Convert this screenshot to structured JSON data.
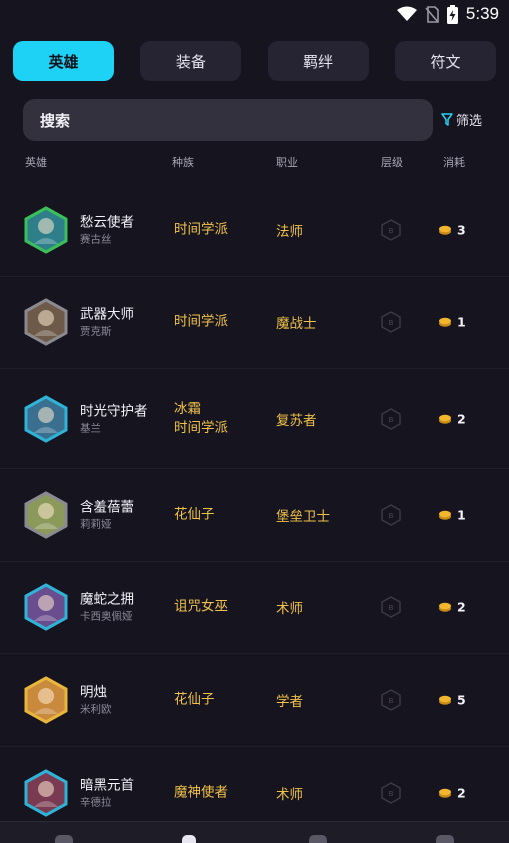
{
  "status_bar": {
    "time": "5:39",
    "icons": [
      "wifi-icon",
      "no-sim-icon",
      "battery-charging-icon"
    ]
  },
  "tabs": [
    {
      "label": "英雄",
      "active": true
    },
    {
      "label": "装备",
      "active": false
    },
    {
      "label": "羁绊",
      "active": false
    },
    {
      "label": "符文",
      "active": false
    }
  ],
  "search": {
    "placeholder": "搜索"
  },
  "filter": {
    "label": "筛选",
    "icon": "filter-icon"
  },
  "columns": {
    "hero": "英雄",
    "origin": "种族",
    "class": "职业",
    "tier": "层级",
    "cost": "消耗"
  },
  "tier_badge": "B",
  "heroes": [
    {
      "name": "愁云使者",
      "subname": "赛古丝",
      "origin": "时间学派",
      "class": "法师",
      "cost": "3",
      "border": "#3bbf5a",
      "portrait": "#2e7f8a"
    },
    {
      "name": "武器大师",
      "subname": "贾克斯",
      "origin": "时间学派",
      "class": "魔战士",
      "cost": "1",
      "border": "#8a8a90",
      "portrait": "#6d5a48"
    },
    {
      "name": "时光守护者",
      "subname": "基兰",
      "origin_lines": [
        "冰霜",
        "时间学派"
      ],
      "class": "复苏者",
      "cost": "2",
      "border": "#2fb3d6",
      "portrait": "#3a6f8f"
    },
    {
      "name": "含羞蓓蕾",
      "subname": "莉莉娅",
      "origin": "花仙子",
      "class": "堡垒卫士",
      "cost": "1",
      "border": "#8a8a90",
      "portrait": "#8b9a5a"
    },
    {
      "name": "魔蛇之拥",
      "subname": "卡西奥佩娅",
      "origin": "诅咒女巫",
      "class": "术师",
      "cost": "2",
      "border": "#2fb3d6",
      "portrait": "#6a4d8e"
    },
    {
      "name": "明烛",
      "subname": "米利欧",
      "origin": "花仙子",
      "class": "学者",
      "cost": "5",
      "border": "#e8b63a",
      "portrait": "#c98a3e"
    },
    {
      "name": "暗黑元首",
      "subname": "辛德拉",
      "origin": "魔神使者",
      "class": "术师",
      "cost": "2",
      "border": "#2fb3d6",
      "portrait": "#7a3b52"
    }
  ],
  "colors": {
    "accent": "#1ed2f6",
    "gold_text": "#f0c24a",
    "background": "#16141f",
    "panel": "#262432"
  }
}
